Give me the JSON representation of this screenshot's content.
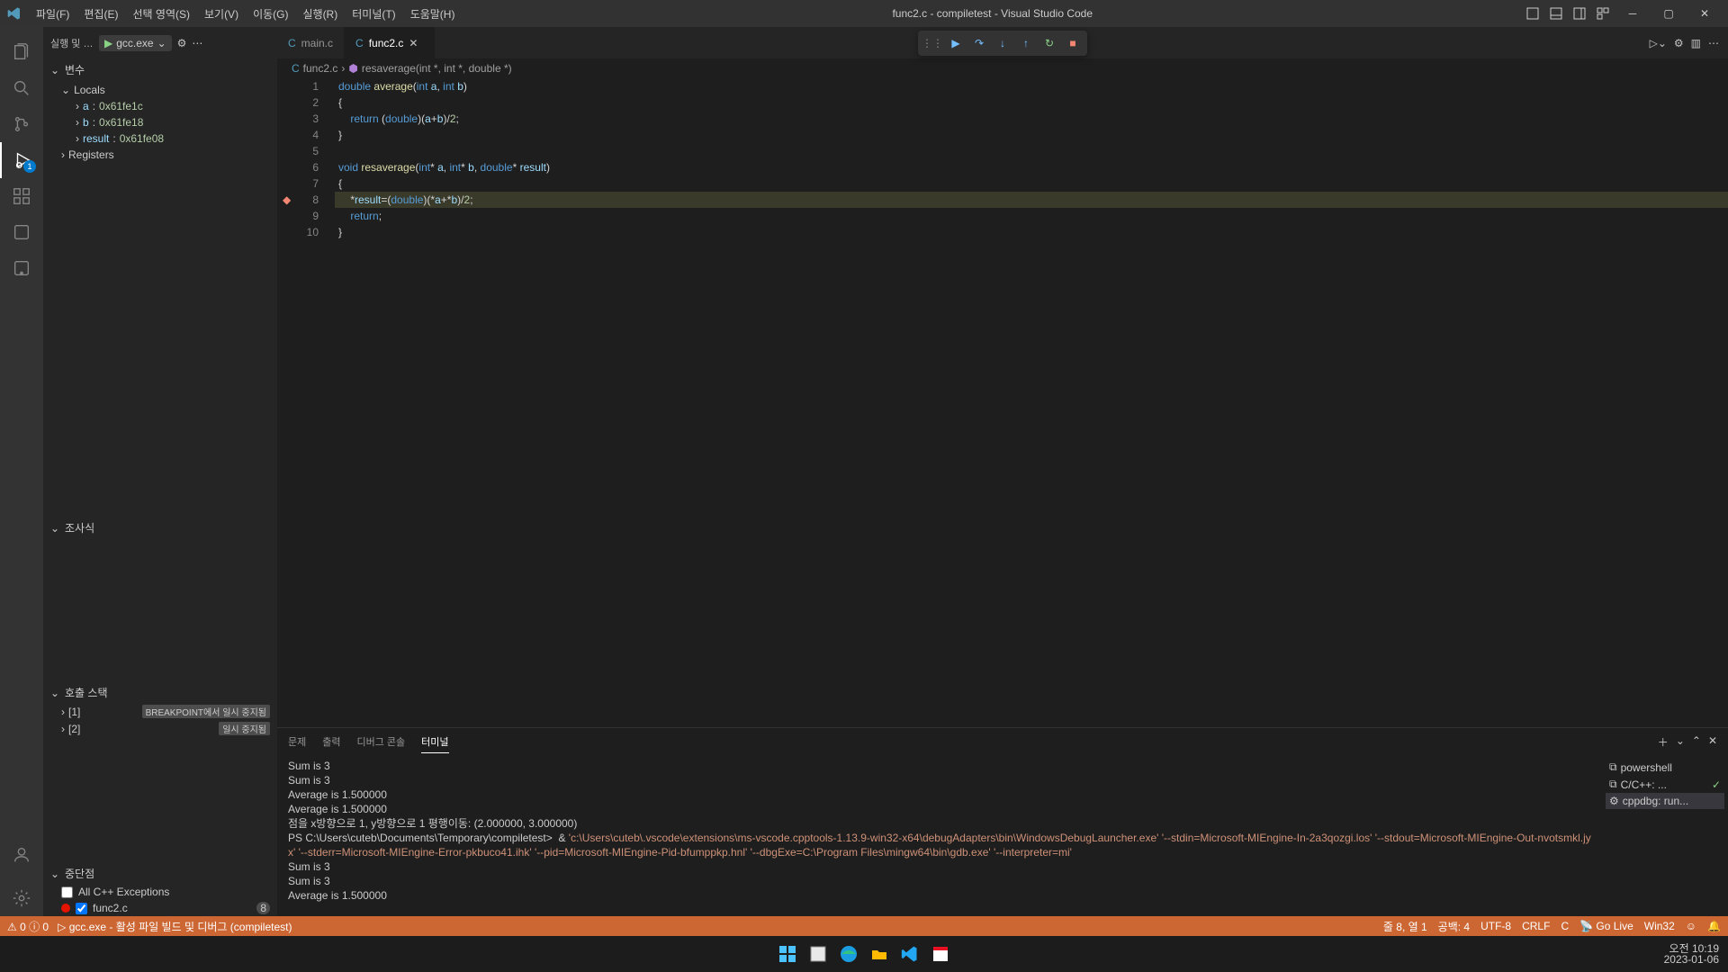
{
  "title": "func2.c - compiletest - Visual Studio Code",
  "menus": [
    "파일(F)",
    "편집(E)",
    "선택 영역(S)",
    "보기(V)",
    "이동(G)",
    "실행(R)",
    "터미널(T)",
    "도움말(H)"
  ],
  "activity_badge": "1",
  "run_header": {
    "label": "실행 및 디...",
    "config": "gcc.exe"
  },
  "sections": {
    "variables": "변수",
    "locals": "Locals",
    "registers": "Registers",
    "watch": "조사식",
    "callstack": "호출 스택",
    "breakpoints": "중단점"
  },
  "locals": [
    {
      "name": "a",
      "value": "0x61fe1c"
    },
    {
      "name": "b",
      "value": "0x61fe18"
    },
    {
      "name": "result",
      "value": "0x61fe08"
    }
  ],
  "callstack": {
    "frames": [
      "[1]",
      "[2]"
    ],
    "badges": [
      "BREAKPOINT에서 일시 중지됨",
      "일시 중지됨"
    ]
  },
  "breakpoints": {
    "allcpp": "All C++ Exceptions",
    "file": "func2.c",
    "linebadge": "8"
  },
  "tabs": [
    {
      "label": "main.c",
      "active": false
    },
    {
      "label": "func2.c",
      "active": true
    }
  ],
  "breadcrumb": {
    "file": "func2.c",
    "symbol": "resaverage(int *, int *, double *)"
  },
  "code_lines": [
    {
      "n": 1,
      "tokens": [
        [
          "kw",
          "double"
        ],
        [
          "op",
          " "
        ],
        [
          "fn",
          "average"
        ],
        [
          "op",
          "("
        ],
        [
          "type",
          "int"
        ],
        [
          "op",
          " "
        ],
        [
          "var",
          "a"
        ],
        [
          "op",
          ", "
        ],
        [
          "type",
          "int"
        ],
        [
          "op",
          " "
        ],
        [
          "var",
          "b"
        ],
        [
          "op",
          ")"
        ]
      ]
    },
    {
      "n": 2,
      "tokens": [
        [
          "op",
          "{"
        ]
      ]
    },
    {
      "n": 3,
      "tokens": [
        [
          "op",
          "    "
        ],
        [
          "kw",
          "return"
        ],
        [
          "op",
          " ("
        ],
        [
          "type",
          "double"
        ],
        [
          "op",
          ")("
        ],
        [
          "var",
          "a"
        ],
        [
          "op",
          "+"
        ],
        [
          "var",
          "b"
        ],
        [
          "op",
          ")/"
        ],
        [
          "num",
          "2"
        ],
        [
          "op",
          ";"
        ]
      ]
    },
    {
      "n": 4,
      "tokens": [
        [
          "op",
          "}"
        ]
      ]
    },
    {
      "n": 5,
      "tokens": []
    },
    {
      "n": 6,
      "tokens": [
        [
          "kw",
          "void"
        ],
        [
          "op",
          " "
        ],
        [
          "fn",
          "resaverage"
        ],
        [
          "op",
          "("
        ],
        [
          "type",
          "int"
        ],
        [
          "op",
          "* "
        ],
        [
          "var",
          "a"
        ],
        [
          "op",
          ", "
        ],
        [
          "type",
          "int"
        ],
        [
          "op",
          "* "
        ],
        [
          "var",
          "b"
        ],
        [
          "op",
          ", "
        ],
        [
          "type",
          "double"
        ],
        [
          "op",
          "* "
        ],
        [
          "var",
          "result"
        ],
        [
          "op",
          ")"
        ]
      ]
    },
    {
      "n": 7,
      "tokens": [
        [
          "op",
          "{"
        ]
      ]
    },
    {
      "n": 8,
      "current": true,
      "bp": true,
      "tokens": [
        [
          "op",
          "    *"
        ],
        [
          "var",
          "result"
        ],
        [
          "op",
          "=("
        ],
        [
          "type",
          "double"
        ],
        [
          "op",
          ")(*"
        ],
        [
          "var",
          "a"
        ],
        [
          "op",
          "+*"
        ],
        [
          "var",
          "b"
        ],
        [
          "op",
          ")/"
        ],
        [
          "num",
          "2"
        ],
        [
          "op",
          ";"
        ]
      ]
    },
    {
      "n": 9,
      "tokens": [
        [
          "op",
          "    "
        ],
        [
          "kw",
          "return"
        ],
        [
          "op",
          ";"
        ]
      ]
    },
    {
      "n": 10,
      "tokens": [
        [
          "op",
          "}"
        ]
      ]
    }
  ],
  "panel_tabs": [
    "문제",
    "출력",
    "디버그 콘솔",
    "터미널"
  ],
  "terminal_side": [
    "powershell",
    "C/C++: ...",
    "cppdbg: run..."
  ],
  "terminal_lines": [
    {
      "t": "Sum is 3"
    },
    {
      "t": "Sum is 3"
    },
    {
      "t": "Average is 1.500000"
    },
    {
      "t": "Average is 1.500000"
    },
    {
      "t": "점을 x방향으로 1, y방향으로 1 평행이동: (2.000000, 3.000000)"
    },
    {
      "prompt": "PS C:\\Users\\cuteb\\Documents\\Temporary\\compiletest> ",
      "amp": " & ",
      "cmd": "'c:\\Users\\cuteb\\.vscode\\extensions\\ms-vscode.cpptools-1.13.9-win32-x64\\debugAdapters\\bin\\WindowsDebugLauncher.exe' '--stdin=Microsoft-MIEngine-In-2a3qozgi.los' '--stdout=Microsoft-MIEngine-Out-nvotsmkl.jyx' '--stderr=Microsoft-MIEngine-Error-pkbuco41.ihk' '--pid=Microsoft-MIEngine-Pid-bfumppkp.hnl' '--dbgExe=C:\\Program Files\\mingw64\\bin\\gdb.exe' '--interpreter=mi'"
    },
    {
      "t": "Sum is 3"
    },
    {
      "t": "Sum is 3"
    },
    {
      "t": "Average is 1.500000"
    }
  ],
  "status": {
    "left": [
      "⚠ 0 ⓘ 0",
      "gcc.exe - 활성 파일 빌드 및 디버그 (compiletest)"
    ],
    "right": [
      "줄 8, 열 1",
      "공백: 4",
      "UTF-8",
      "CRLF",
      "C",
      "Go Live",
      "Win32"
    ]
  },
  "tray": {
    "time": "오전 10:19",
    "date": "2023-01-06"
  }
}
